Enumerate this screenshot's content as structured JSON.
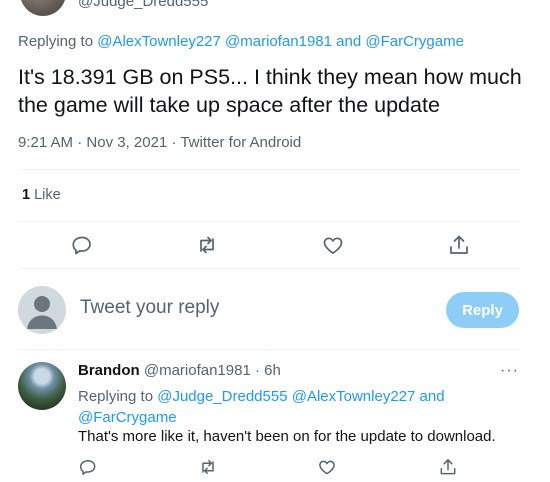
{
  "top": {
    "handle": "@Judge_Dredd555"
  },
  "main_tweet": {
    "replying_label": "Replying to",
    "mentions": [
      "@AlexTownley227",
      "@mariofan1981"
    ],
    "and_label": "and",
    "last_mention": "@FarCrygame",
    "text": "It's 18.391 GB on PS5... I think they mean how much the game will take up space after the update",
    "time": "9:21 AM",
    "date": "Nov 3, 2021",
    "source": "Twitter for Android",
    "sep": " · ",
    "like_count": "1",
    "like_label": "Like"
  },
  "compose": {
    "placeholder": "Tweet your reply",
    "button": "Reply"
  },
  "reply_tweet": {
    "name": "Brandon",
    "handle": "@mariofan1981",
    "time": "6h",
    "sep": " · ",
    "more": "···",
    "replying_label": "Replying to",
    "mentions": [
      "@Judge_Dredd555",
      "@AlexTownley227"
    ],
    "and_label": "and",
    "last_mention": "@FarCrygame",
    "text": "That's more like it, haven't been on for the update to download."
  },
  "icons": {
    "reply": "reply-icon",
    "retweet": "retweet-icon",
    "like": "heart-icon",
    "share": "share-icon"
  },
  "colors": {
    "accent": "#1d9bf0",
    "muted": "#536471",
    "reply_button": "#8ecdf8"
  }
}
